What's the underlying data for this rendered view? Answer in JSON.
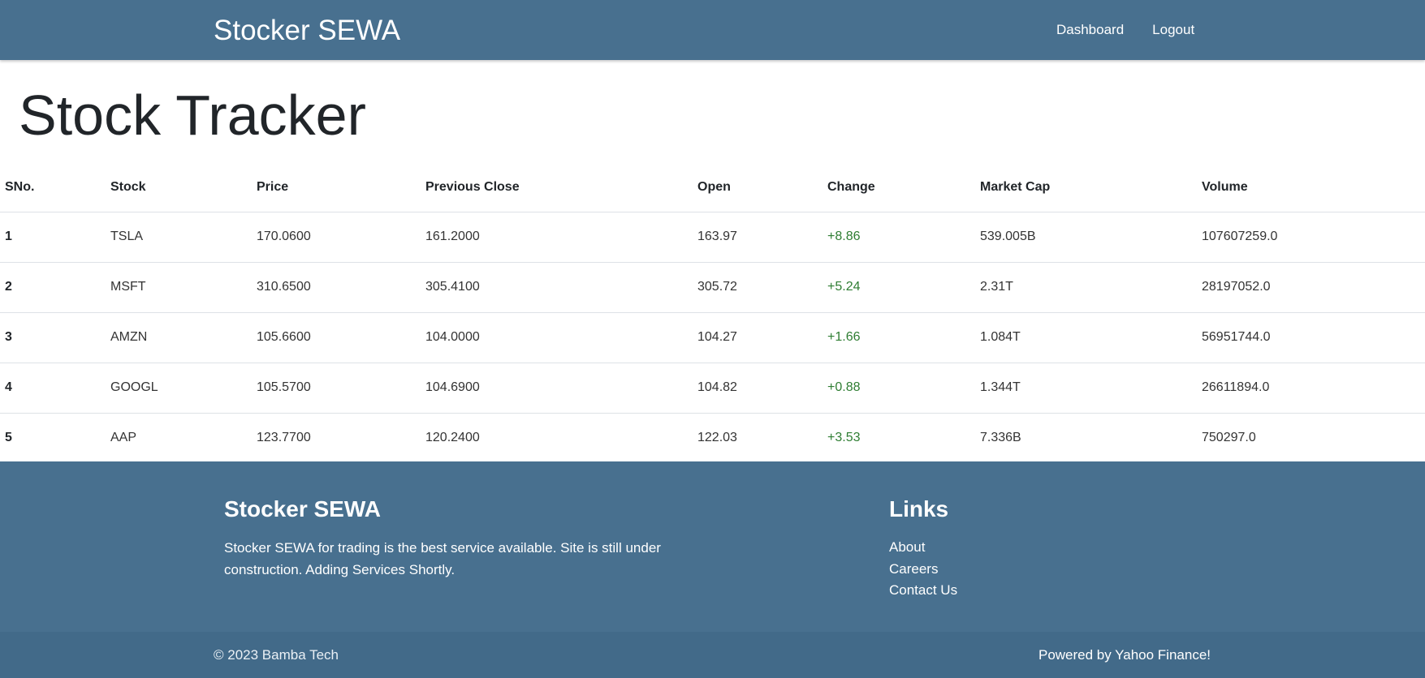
{
  "navbar": {
    "brand": "Stocker SEWA",
    "links": [
      "Dashboard",
      "Logout"
    ]
  },
  "page_title": "Stock Tracker",
  "table": {
    "headers": [
      "SNo.",
      "Stock",
      "Price",
      "Previous Close",
      "Open",
      "Change",
      "Market Cap",
      "Volume"
    ],
    "rows": [
      [
        "1",
        "TSLA",
        "170.0600",
        "161.2000",
        "163.97",
        "+8.86",
        "539.005B",
        "107607259.0"
      ],
      [
        "2",
        "MSFT",
        "310.6500",
        "305.4100",
        "305.72",
        "+5.24",
        "2.31T",
        "28197052.0"
      ],
      [
        "3",
        "AMZN",
        "105.6600",
        "104.0000",
        "104.27",
        "+1.66",
        "1.084T",
        "56951744.0"
      ],
      [
        "4",
        "GOOGL",
        "105.5700",
        "104.6900",
        "104.82",
        "+0.88",
        "1.344T",
        "26611894.0"
      ],
      [
        "5",
        "AAP",
        "123.7700",
        "120.2400",
        "122.03",
        "+3.53",
        "7.336B",
        "750297.0"
      ]
    ]
  },
  "footer": {
    "title": "Stocker SEWA",
    "description": "Stocker SEWA for trading is the best service available. Site is still under construction. Adding Services Shortly.",
    "links_title": "Links",
    "links": [
      "About",
      "Careers",
      "Contact Us"
    ]
  },
  "bottom": {
    "copyright": "© 2023 Bamba Tech",
    "powered": "Powered by Yahoo Finance!"
  },
  "colors": {
    "navbar_bg": "#48708f",
    "change_positive": "#2e7d32"
  }
}
